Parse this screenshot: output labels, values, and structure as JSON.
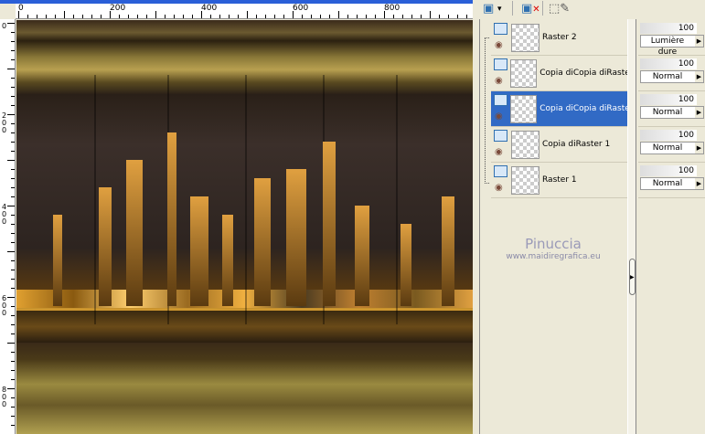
{
  "ruler": {
    "top_labels": [
      "0",
      "200",
      "400",
      "600",
      "800"
    ],
    "left_labels": [
      "0",
      "200",
      "400",
      "600",
      "800"
    ]
  },
  "toolbar": {
    "new_layer_icon": "layer-icon",
    "delete_icon": "delete-layer-icon",
    "mask_icon": "edit-selection-icon",
    "dropdown": "▾"
  },
  "layers": [
    {
      "name": "Raster 2",
      "opacity": "100",
      "blend": "Lumière dure",
      "selected": false
    },
    {
      "name": "Copia diCopia diRaster",
      "opacity": "100",
      "blend": "Normal",
      "selected": false
    },
    {
      "name": "Copia diCopia diRaster",
      "opacity": "100",
      "blend": "Normal",
      "selected": true
    },
    {
      "name": "Copia diRaster 1",
      "opacity": "100",
      "blend": "Normal",
      "selected": false
    },
    {
      "name": "Raster 1",
      "opacity": "100",
      "blend": "Normal",
      "selected": false
    }
  ],
  "watermark": {
    "name": "Pinuccia",
    "url": "www.maidiregrafica.eu"
  },
  "colors": {
    "selection": "#316ac5",
    "panel": "#ece9d8"
  }
}
